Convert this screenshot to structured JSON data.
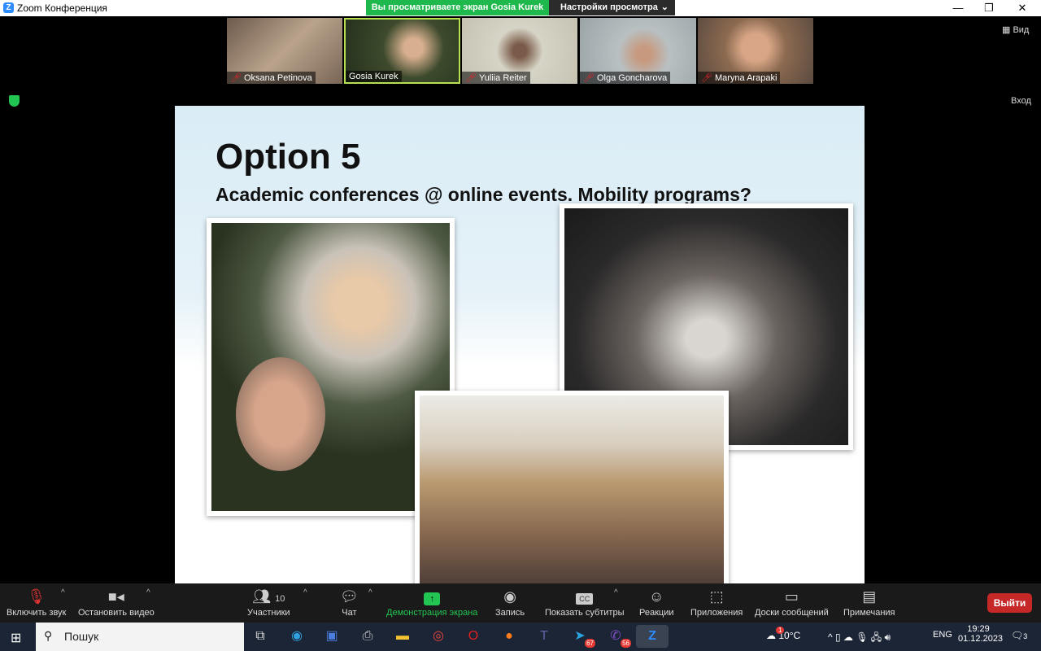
{
  "window": {
    "title": "Zoom Конференция",
    "min": "—",
    "max": "❐",
    "close": "✕"
  },
  "banner": {
    "viewing": "Вы просматриваете экран Gosia Kurek",
    "settings": "Настройки просмотра",
    "chevron": "⌄"
  },
  "view_button": "Вид",
  "enter_label": "Вход",
  "participants": [
    {
      "name": "Oksana Petinova",
      "muted": true,
      "color": "#8a7a6a"
    },
    {
      "name": "Gosia Kurek",
      "muted": false,
      "color": "#4d5a3a"
    },
    {
      "name": "Yuliia Reiter",
      "muted": true,
      "color": "#c9c6b8"
    },
    {
      "name": "Olga Goncharova",
      "muted": true,
      "color": "#a9b1b3"
    },
    {
      "name": "Maryna Arapaki",
      "muted": true,
      "color": "#8e6a52"
    }
  ],
  "slide": {
    "title": "Option 5",
    "subtitle": "Academic conferences @ online events. Mobility programs?"
  },
  "toolbar": {
    "unmute": "Включить звук",
    "stop_video": "Остановить видео",
    "participants": "Участники",
    "participants_count": "10",
    "chat": "Чат",
    "share": "Демонстрация экрана",
    "record": "Запись",
    "captions": "Показать субтитры",
    "captions_icon": "CC",
    "reactions": "Реакции",
    "apps": "Приложения",
    "whiteboards": "Доски сообщений",
    "notes": "Примечания",
    "leave": "Выйти"
  },
  "taskbar": {
    "search": "Пошук",
    "telegram_badge": "67",
    "viber_badge": "56",
    "weather_badge": "1",
    "temperature": "10°C",
    "lang": "ENG",
    "time": "19:29",
    "date": "01.12.2023",
    "notifications": "3"
  }
}
